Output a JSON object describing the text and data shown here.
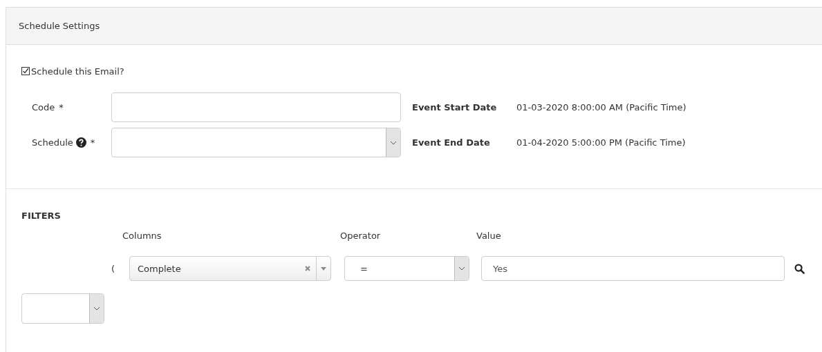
{
  "panel": {
    "title": "Schedule Settings"
  },
  "schedule_email": {
    "label": "Schedule this Email?",
    "checked": true
  },
  "fields": [
    {
      "kind": "text",
      "label": "Code",
      "required_mark": "*",
      "help": false
    },
    {
      "kind": "select",
      "label": "Schedule",
      "required_mark": "*",
      "help": true
    }
  ],
  "event_info": [
    {
      "label": "Event Start Date",
      "value": "01-03-2020 8:00:00 AM (Pacific Time)"
    },
    {
      "label": "Event End Date",
      "value": "01-04-2020 5:00:00 PM (Pacific Time)"
    }
  ],
  "filters": {
    "title": "FILTERS",
    "headers": [
      "Columns",
      "Operator",
      "Value"
    ],
    "rows": [
      {
        "open_paren": "(",
        "column": "Complete",
        "operator": "=",
        "value": "Yes"
      }
    ]
  }
}
